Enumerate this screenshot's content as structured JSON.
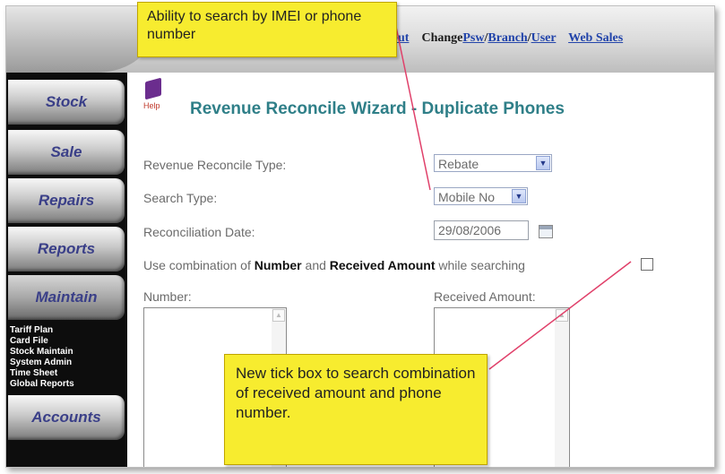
{
  "header": {
    "logout_partial": "out",
    "change_prefix": "Change",
    "change_psw": "Psw",
    "change_branch": "Branch",
    "change_user": "User",
    "web_sales": "Web Sales"
  },
  "sidebar": {
    "items": [
      {
        "label": "Stock"
      },
      {
        "label": "Sale"
      },
      {
        "label": "Repairs"
      },
      {
        "label": "Reports"
      },
      {
        "label": "Maintain"
      },
      {
        "label": "Accounts"
      }
    ],
    "submenu": [
      "Tariff Plan",
      "Card File",
      "Stock Maintain",
      "System Admin",
      "Time Sheet",
      "Global Reports"
    ]
  },
  "main": {
    "help_label": "Help",
    "title": "Revenue Reconcile Wizard - Duplicate Phones",
    "fields": {
      "reconcile_type_label": "Revenue Reconcile Type:",
      "reconcile_type_value": "Rebate",
      "search_type_label": "Search Type:",
      "search_type_value": "Mobile No",
      "date_label": "Reconciliation Date:",
      "date_value": "29/08/2006",
      "combo_prefix": "Use combination of ",
      "combo_number": "Number",
      "combo_and": " and ",
      "combo_received": "Received Amount",
      "combo_suffix": " while searching",
      "number_label": "Number:",
      "received_label": "Received Amount:"
    }
  },
  "callouts": {
    "top": "Ability to search by IMEI or phone number",
    "bottom": "New tick box to search combination of received amount and phone number."
  },
  "colors": {
    "title": "#2f7f88",
    "nav_text": "#3a3f88",
    "callout_bg": "#f7ec2f",
    "pointer": "#e0406a"
  }
}
